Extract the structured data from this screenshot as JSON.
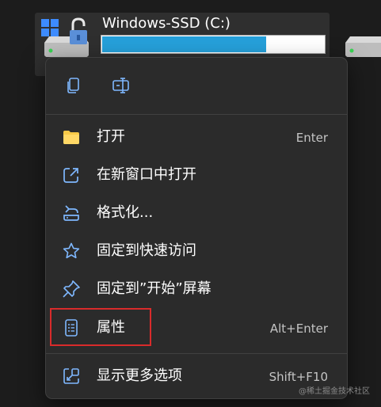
{
  "drive": {
    "name": "Windows-SSD (C:)",
    "usage_fraction": 0.74
  },
  "menu": {
    "quick_actions": [
      {
        "icon": "copy-icon",
        "name": "copy-button"
      },
      {
        "icon": "rename-icon",
        "name": "rename-button"
      }
    ],
    "items": [
      {
        "label": "打开",
        "shortcut": "Enter",
        "icon": "folder-icon"
      },
      {
        "label": "在新窗口中打开",
        "shortcut": "",
        "icon": "open-new-window-icon"
      },
      {
        "label": "格式化...",
        "shortcut": "",
        "icon": "format-drive-icon"
      },
      {
        "label": "固定到快速访问",
        "shortcut": "",
        "icon": "star-icon"
      },
      {
        "label": "固定到”开始”屏幕",
        "shortcut": "",
        "icon": "pin-icon"
      },
      {
        "label": "属性",
        "shortcut": "Alt+Enter",
        "icon": "properties-icon"
      },
      {
        "label": "显示更多选项",
        "shortcut": "Shift+F10",
        "icon": "show-more-options-icon"
      }
    ]
  },
  "watermark": "@稀土掘金技术社区",
  "colors": {
    "accent": "#26a0da",
    "menu_background": "#2b2b2b",
    "highlight_border": "#d92b2b",
    "icon_blue": "#7fb8ff",
    "folder_yellow": "#f7c948"
  }
}
